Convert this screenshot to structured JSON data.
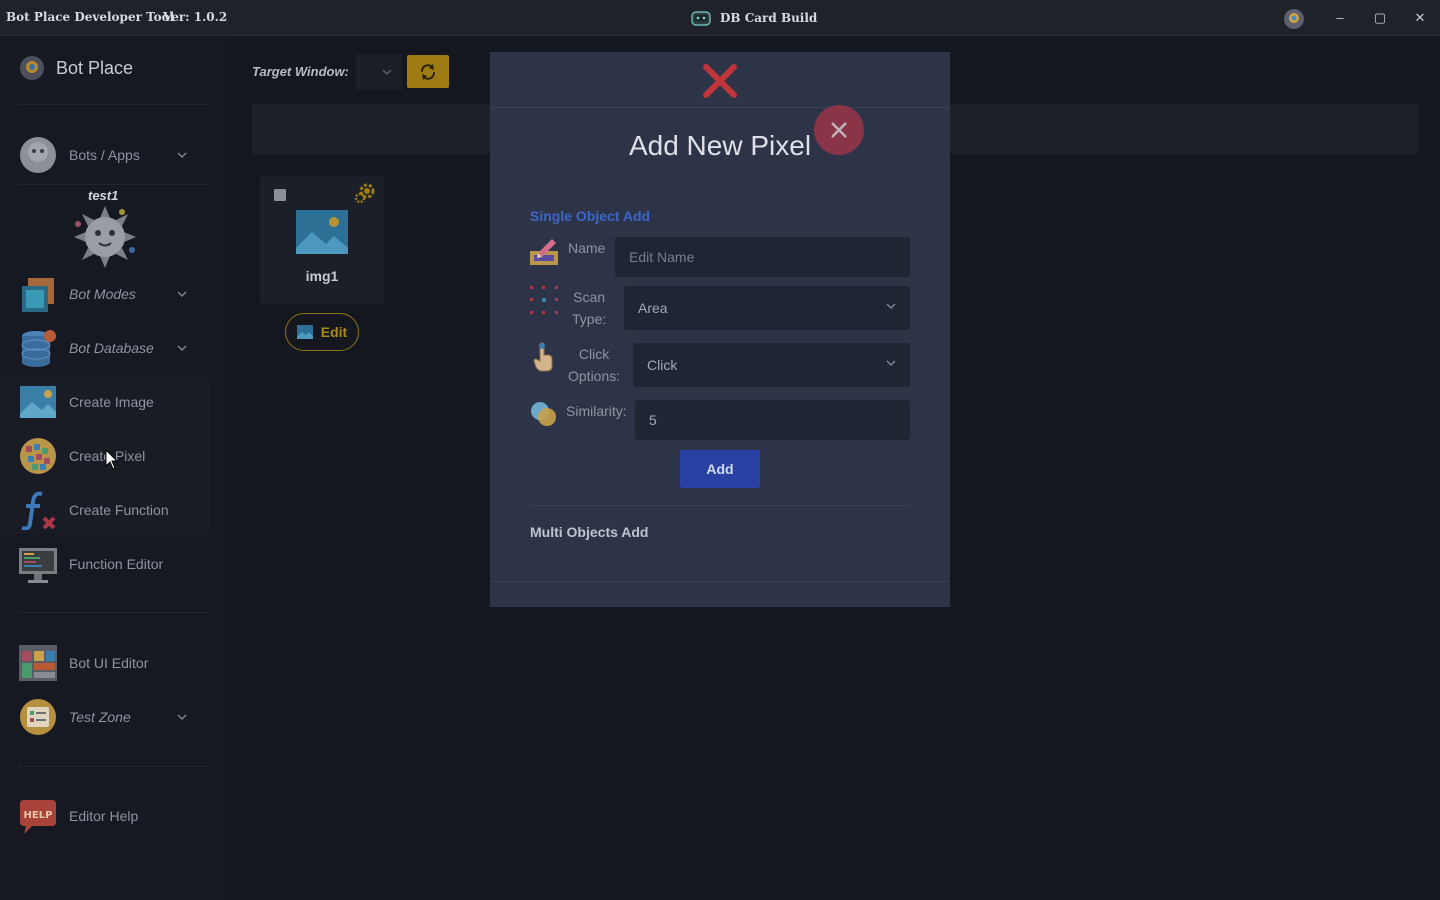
{
  "titlebar": {
    "app_title": "Bot Place Developer Tool",
    "version": "Ver: 1.0.2",
    "doc_title": "DB Card Build",
    "minimize": "–",
    "maximize": "▢",
    "close": "✕"
  },
  "sidebar": {
    "brand": "Bot Place",
    "profile_name": "test1",
    "items": [
      {
        "label": "Bots / Apps",
        "icon": "bot-ball-icon",
        "has_chevron": true
      },
      {
        "label": "Bot Modes",
        "icon": "modes-icon",
        "has_chevron": true
      },
      {
        "label": "Bot Database",
        "icon": "database-icon",
        "has_chevron": true
      },
      {
        "label": "Create Image",
        "icon": "image-icon",
        "has_chevron": false
      },
      {
        "label": "Create Pixel",
        "icon": "pixel-globe-icon",
        "has_chevron": false
      },
      {
        "label": "Create Function",
        "icon": "function-icon",
        "has_chevron": false
      },
      {
        "label": "Function Editor",
        "icon": "monitor-code-icon",
        "has_chevron": false
      },
      {
        "label": "Bot UI Editor",
        "icon": "ui-grid-icon",
        "has_chevron": false
      },
      {
        "label": "Test Zone",
        "icon": "test-zone-icon",
        "has_chevron": true
      },
      {
        "label": "Editor Help",
        "icon": "help-icon",
        "has_chevron": false
      }
    ]
  },
  "main": {
    "target_label": "Target Window:",
    "card": {
      "name": "img1"
    },
    "edit_label": "Edit"
  },
  "modal": {
    "title": "Add New Pixel",
    "section_single": "Single Object Add",
    "fields": {
      "name_label": "Name",
      "name_placeholder": "Edit Name",
      "scan_label_1": "Scan",
      "scan_label_2": "Type:",
      "scan_value": "Area",
      "click_label_1": "Click",
      "click_label_2": "Options:",
      "click_value": "Click",
      "similarity_label": "Similarity:",
      "similarity_value": "5"
    },
    "add_label": "Add",
    "section_multi": "Multi Objects Add"
  },
  "colors": {
    "accent_blue": "#2841a3",
    "accent_gold": "#9e7c13",
    "danger": "#c0353b"
  }
}
